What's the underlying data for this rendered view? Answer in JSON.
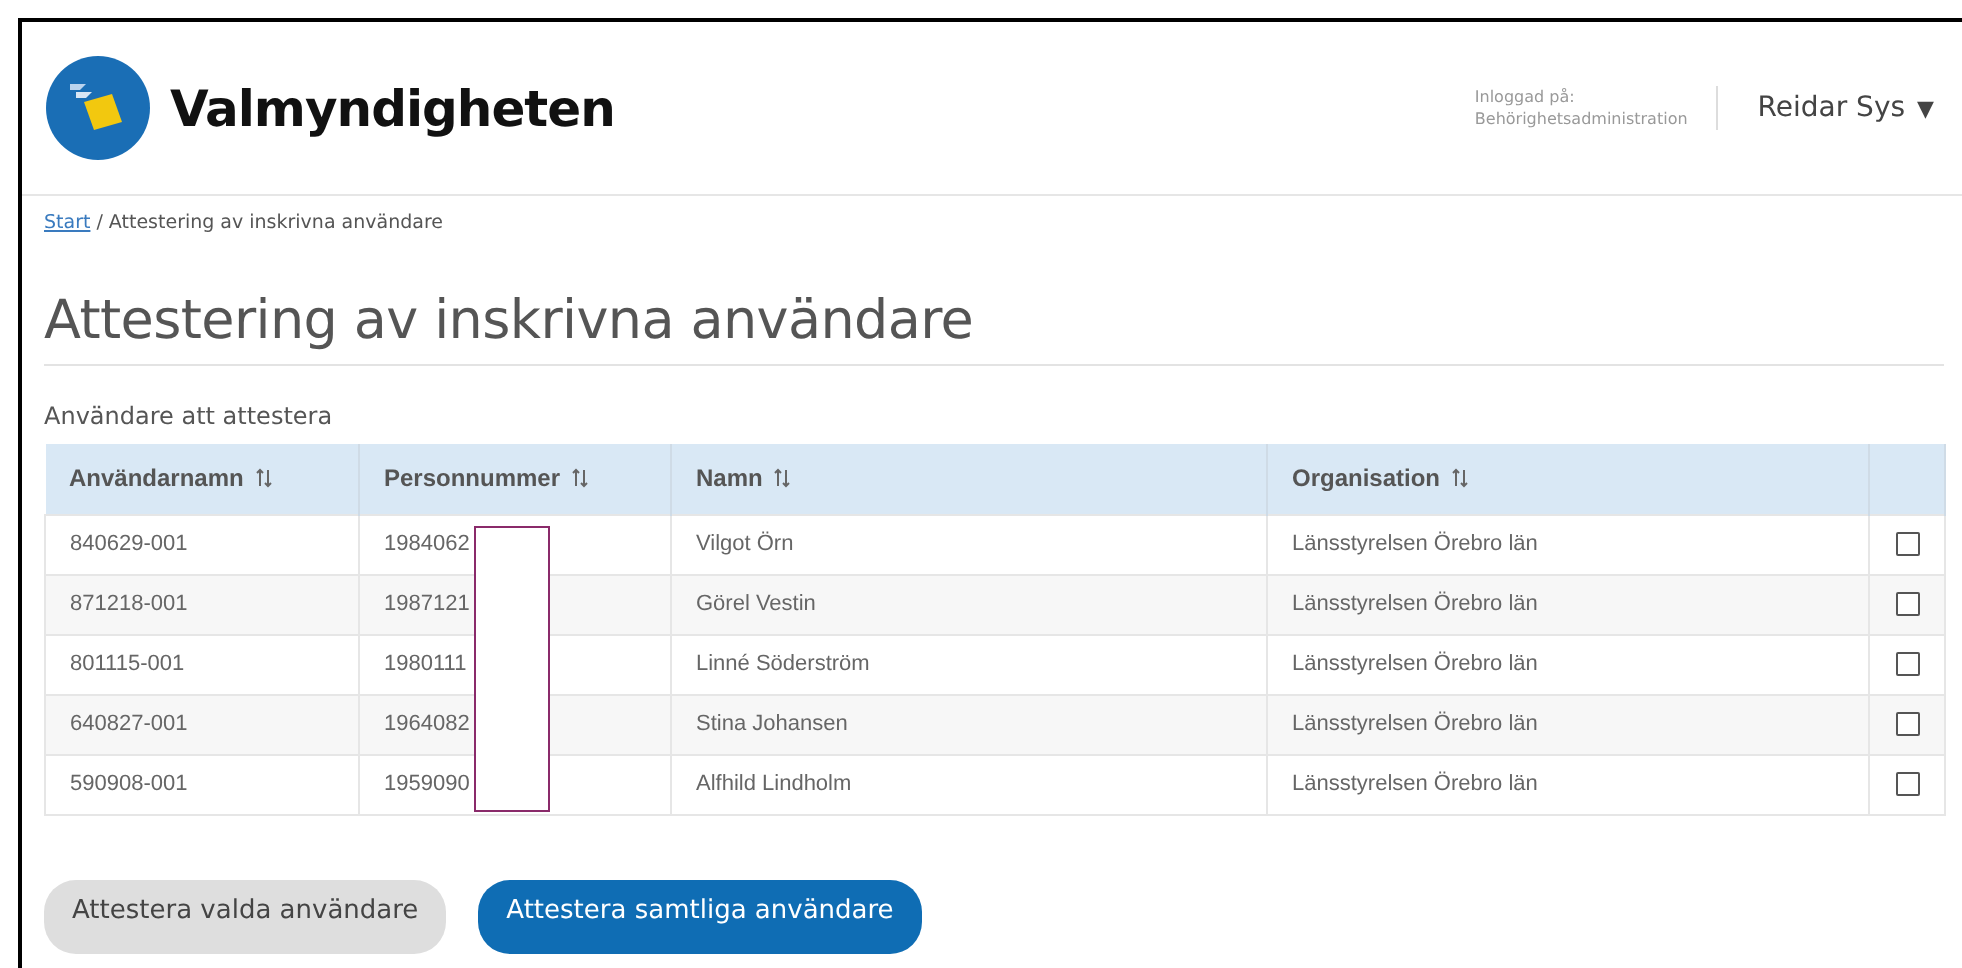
{
  "header": {
    "logo_text": "Valmyndigheten",
    "login_label": "Inloggad på:",
    "login_system": "Behörighetsadministration",
    "user": "Reidar Sys",
    "user_caret": "▼"
  },
  "breadcrumb": {
    "link": "Start",
    "separator": "/",
    "current": "Attestering av inskrivna användare"
  },
  "title": "Attestering av inskrivna användare",
  "table": {
    "caption": "Användare att attestera",
    "columns": [
      {
        "label": "Användarnamn"
      },
      {
        "label": "Personnummer"
      },
      {
        "label": "Namn"
      },
      {
        "label": "Organisation"
      }
    ],
    "rows": [
      {
        "username": "840629-001",
        "personnummer": "1984062",
        "name": "Vilgot Örn",
        "organisation": "Länsstyrelsen Örebro län",
        "checked": false
      },
      {
        "username": "871218-001",
        "personnummer": "1987121",
        "name": "Görel Vestin",
        "organisation": "Länsstyrelsen Örebro län",
        "checked": false
      },
      {
        "username": "801115-001",
        "personnummer": "1980111",
        "name": "Linné Söderström",
        "organisation": "Länsstyrelsen Örebro län",
        "checked": false
      },
      {
        "username": "640827-001",
        "personnummer": "1964082",
        "name": "Stina Johansen",
        "organisation": "Länsstyrelsen Örebro län",
        "checked": false
      },
      {
        "username": "590908-001",
        "personnummer": "1959090",
        "name": "Alfhild Lindholm",
        "organisation": "Länsstyrelsen Örebro län",
        "checked": false
      }
    ]
  },
  "buttons": [
    {
      "label": "Attestera valda användare",
      "kind": "secondary"
    },
    {
      "label": "Attestera samtliga användare",
      "kind": "primary"
    }
  ]
}
